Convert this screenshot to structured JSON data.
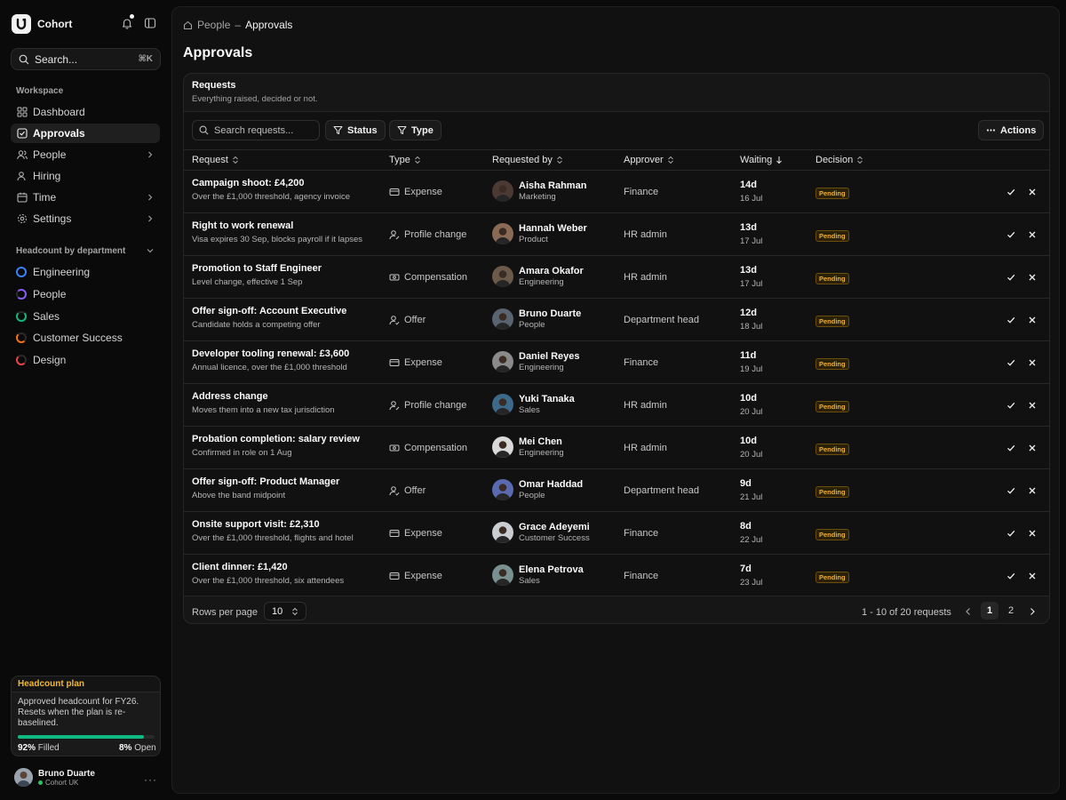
{
  "app": {
    "name": "Cohort",
    "logo_letter": "U"
  },
  "sidebar": {
    "search": {
      "placeholder": "Search...",
      "shortcut": "⌘K"
    },
    "workspace_label": "Workspace",
    "nav": [
      {
        "label": "Dashboard",
        "icon": "dashboard-icon"
      },
      {
        "label": "Approvals",
        "icon": "check-square-icon",
        "active": true
      },
      {
        "label": "People",
        "icon": "users-icon",
        "has_chevron": true
      },
      {
        "label": "Hiring",
        "icon": "user-plus-icon"
      },
      {
        "label": "Time",
        "icon": "calendar-icon",
        "has_chevron": true
      },
      {
        "label": "Settings",
        "icon": "gear-icon",
        "has_chevron": true
      }
    ],
    "departments_label": "Headcount by department",
    "departments": [
      {
        "label": "Engineering",
        "color": "#3b82f6",
        "ring_fill": 1.0
      },
      {
        "label": "People",
        "color": "#8b5cf6",
        "ring_fill": 0.75
      },
      {
        "label": "Sales",
        "color": "#10b981",
        "ring_fill": 0.7
      },
      {
        "label": "Customer Success",
        "color": "#f97316",
        "ring_fill": 0.6
      },
      {
        "label": "Design",
        "color": "#ef4444",
        "ring_fill": 0.55
      }
    ],
    "plan": {
      "title": "Headcount plan",
      "text": "Approved headcount for FY26. Resets when the plan is re-baselined.",
      "filled_pct": "92%",
      "filled_label": "Filled",
      "open_pct": "8%",
      "open_label": "Open",
      "filled_fraction": 0.92,
      "accent": "#f5b82e",
      "bar_color": "#10b981"
    },
    "user": {
      "name": "Bruno Duarte",
      "org": "Cohort UK",
      "menu": "···"
    }
  },
  "breadcrumb": {
    "parent": "People",
    "separator": "–",
    "current": "Approvals"
  },
  "page": {
    "title": "Approvals",
    "card_title": "Requests",
    "card_subtitle": "Everything raised, decided or not."
  },
  "toolbar": {
    "search_placeholder": "Search requests...",
    "status_label": "Status",
    "type_label": "Type",
    "actions_label": "Actions"
  },
  "table": {
    "columns": [
      "Request",
      "Type",
      "Requested by",
      "Approver",
      "Waiting",
      "Decision"
    ],
    "rows": [
      {
        "title": "Campaign shoot: £4,200",
        "desc": "Over the £1,000 threshold, agency invoice",
        "type": "Expense",
        "type_icon": "receipt-icon",
        "by": "Aisha Rahman",
        "dept": "Marketing",
        "approver": "Finance",
        "wait": "14d",
        "date": "16 Jul",
        "decision": "Pending",
        "avatar_color": "#4a3a33"
      },
      {
        "title": "Right to work renewal",
        "desc": "Visa expires 30 Sep, blocks payroll if it lapses",
        "type": "Profile change",
        "type_icon": "user-edit-icon",
        "by": "Hannah Weber",
        "dept": "Product",
        "approver": "HR admin",
        "wait": "13d",
        "date": "17 Jul",
        "decision": "Pending",
        "avatar_color": "#8a6a55"
      },
      {
        "title": "Promotion to Staff Engineer",
        "desc": "Level change, effective 1 Sep",
        "type": "Compensation",
        "type_icon": "banknote-icon",
        "by": "Amara Okafor",
        "dept": "Engineering",
        "approver": "HR admin",
        "wait": "13d",
        "date": "17 Jul",
        "decision": "Pending",
        "avatar_color": "#6b5a4a"
      },
      {
        "title": "Offer sign-off: Account Executive",
        "desc": "Candidate holds a competing offer",
        "type": "Offer",
        "type_icon": "user-check-icon",
        "by": "Bruno Duarte",
        "dept": "People",
        "approver": "Department head",
        "wait": "12d",
        "date": "18 Jul",
        "decision": "Pending",
        "avatar_color": "#5a6470"
      },
      {
        "title": "Developer tooling renewal: £3,600",
        "desc": "Annual licence, over the £1,000 threshold",
        "type": "Expense",
        "type_icon": "receipt-icon",
        "by": "Daniel Reyes",
        "dept": "Engineering",
        "approver": "Finance",
        "wait": "11d",
        "date": "19 Jul",
        "decision": "Pending",
        "avatar_color": "#8a8a8a"
      },
      {
        "title": "Address change",
        "desc": "Moves them into a new tax jurisdiction",
        "type": "Profile change",
        "type_icon": "user-edit-icon",
        "by": "Yuki Tanaka",
        "dept": "Sales",
        "approver": "HR admin",
        "wait": "10d",
        "date": "20 Jul",
        "decision": "Pending",
        "avatar_color": "#3d6a8a"
      },
      {
        "title": "Probation completion: salary review",
        "desc": "Confirmed in role on 1 Aug",
        "type": "Compensation",
        "type_icon": "banknote-icon",
        "by": "Mei Chen",
        "dept": "Engineering",
        "approver": "HR admin",
        "wait": "10d",
        "date": "20 Jul",
        "decision": "Pending",
        "avatar_color": "#d9d9d9"
      },
      {
        "title": "Offer sign-off: Product Manager",
        "desc": "Above the band midpoint",
        "type": "Offer",
        "type_icon": "user-check-icon",
        "by": "Omar Haddad",
        "dept": "People",
        "approver": "Department head",
        "wait": "9d",
        "date": "21 Jul",
        "decision": "Pending",
        "avatar_color": "#5a6ab0"
      },
      {
        "title": "Onsite support visit: £2,310",
        "desc": "Over the £1,000 threshold, flights and hotel",
        "type": "Expense",
        "type_icon": "receipt-icon",
        "by": "Grace Adeyemi",
        "dept": "Customer Success",
        "approver": "Finance",
        "wait": "8d",
        "date": "22 Jul",
        "decision": "Pending",
        "avatar_color": "#c9ccd1"
      },
      {
        "title": "Client dinner: £1,420",
        "desc": "Over the £1,000 threshold, six attendees",
        "type": "Expense",
        "type_icon": "receipt-icon",
        "by": "Elena Petrova",
        "dept": "Sales",
        "approver": "Finance",
        "wait": "7d",
        "date": "23 Jul",
        "decision": "Pending",
        "avatar_color": "#7a9090"
      }
    ]
  },
  "pagination": {
    "rows_label": "Rows per page",
    "rows_value": "10",
    "info": "1 - 10 of 20 requests",
    "pages": [
      "1",
      "2"
    ],
    "current_page": "1"
  }
}
